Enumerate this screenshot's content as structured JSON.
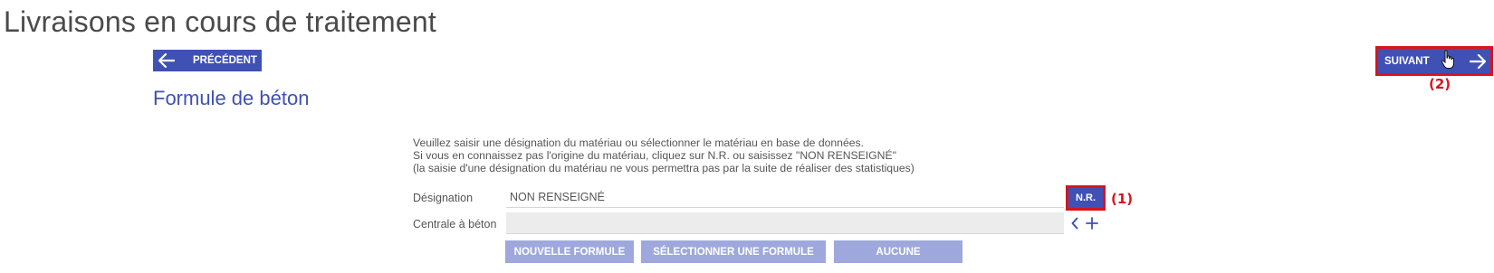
{
  "page": {
    "title": "Livraisons en cours de traitement"
  },
  "nav": {
    "previous_label": "PRÉCÉDENT",
    "next_label": "SUIVANT",
    "previous_icon": "arrow-left-icon",
    "next_icon": "arrow-right-icon"
  },
  "annotations": {
    "note_next": "(2)",
    "note_nr": "(1)"
  },
  "section": {
    "title": "Formule de béton"
  },
  "instructions": {
    "line1": "Veuillez saisir une désignation du matériau ou sélectionner le matériau en base de données.",
    "line2": "Si vous en connaissez pas l'origine du matériau, cliquez sur N.R. ou saisissez \"NON RENSEIGNÉ\"",
    "line3": "(la saisie d'une désignation du matériau ne vous permettra pas par la suite de réaliser des statistiques)"
  },
  "form": {
    "designation_label": "Désignation",
    "designation_value": "NON RENSEIGNÉ",
    "nr_button": "N.R.",
    "centrale_label": "Centrale à béton",
    "centrale_value": ""
  },
  "actions": {
    "nouvelle_formule": "NOUVELLE FORMULE",
    "selectionner_formule": "SÉLECTIONNER UNE FORMULE",
    "aucune": "AUCUNE"
  },
  "colors": {
    "primary": "#3f51b5",
    "primary_disabled": "#9ea8dc",
    "highlight_red": "#d8141c",
    "input_disabled_bg": "#ececec"
  }
}
